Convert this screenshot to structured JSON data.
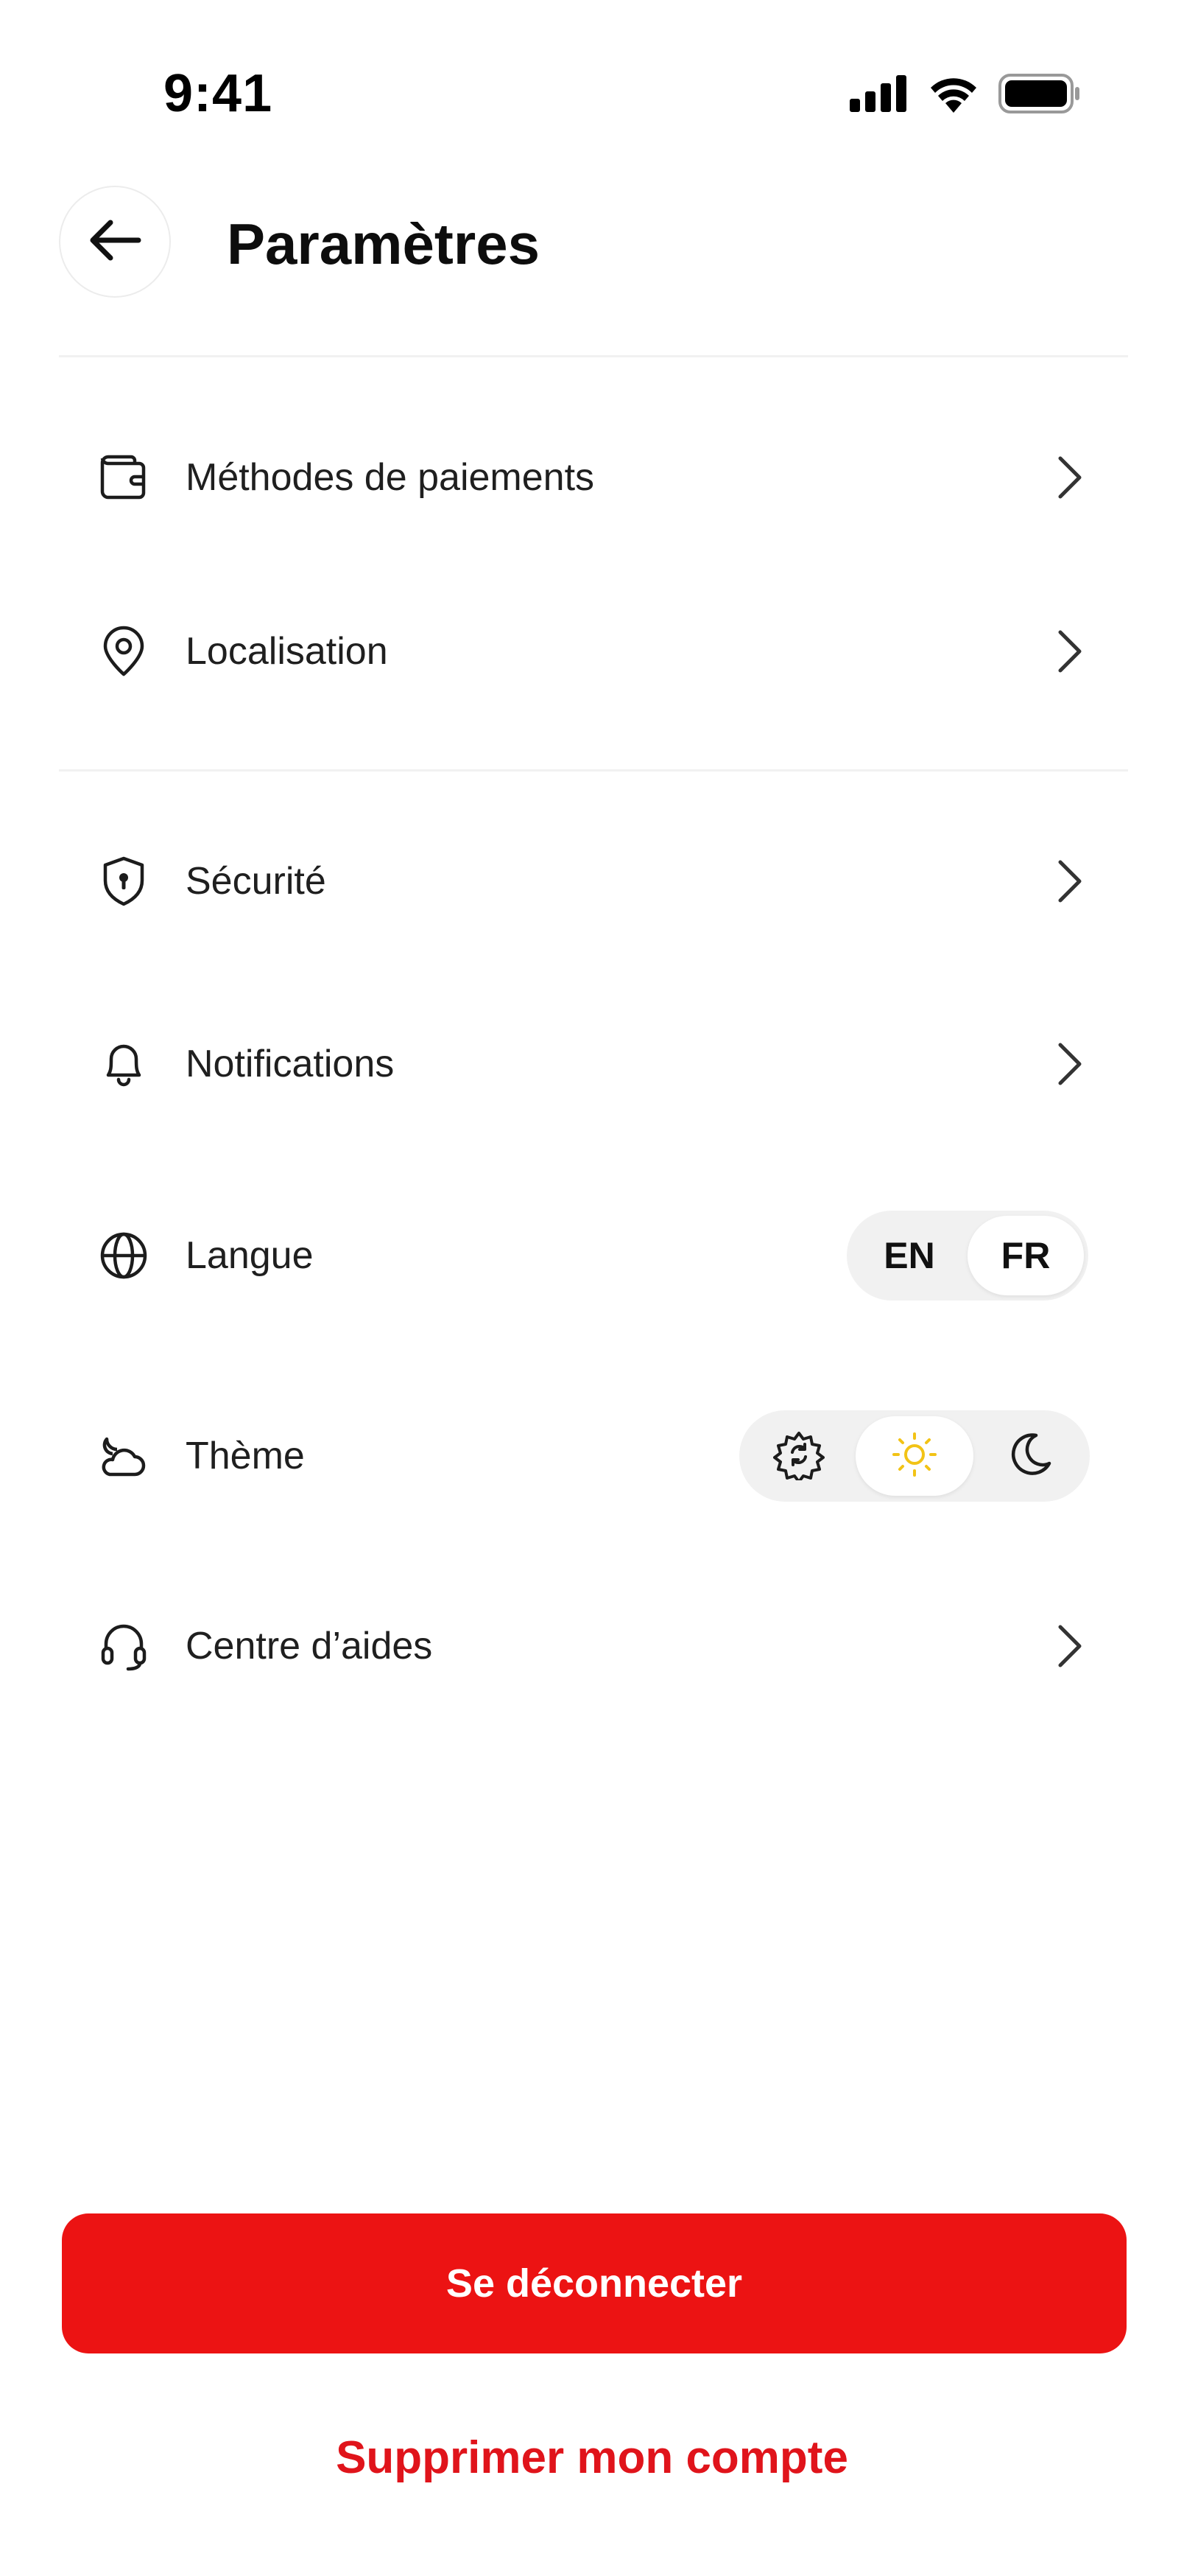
{
  "status_bar": {
    "time": "9:41",
    "icons": [
      "signal-icon",
      "wifi-icon",
      "battery-icon"
    ]
  },
  "header": {
    "title": "Paramètres",
    "back_icon": "arrow-left-icon"
  },
  "sections": [
    {
      "items": [
        {
          "label": "Méthodes de paiements",
          "icon": "wallet-icon",
          "control": "chevron"
        },
        {
          "label": "Localisation",
          "icon": "location-pin-icon",
          "control": "chevron"
        }
      ]
    },
    {
      "items": [
        {
          "label": "Sécurité",
          "icon": "shield-lock-icon",
          "control": "chevron"
        },
        {
          "label": "Notifications",
          "icon": "bell-icon",
          "control": "chevron"
        },
        {
          "label": "Langue",
          "icon": "globe-icon",
          "control": "language-toggle"
        },
        {
          "label": "Thème",
          "icon": "cloud-sun-icon",
          "control": "theme-toggle"
        },
        {
          "label": "Centre d’aides",
          "icon": "headset-icon",
          "control": "chevron"
        }
      ]
    }
  ],
  "language_toggle": {
    "options": [
      "EN",
      "FR"
    ],
    "selected": "FR"
  },
  "theme_toggle": {
    "options": [
      "system-gear-icon",
      "sun-icon",
      "moon-icon"
    ],
    "selected": "sun-icon"
  },
  "actions": {
    "logout_label": "Se déconnecter",
    "delete_account_label": "Supprimer mon compte"
  },
  "colors": {
    "accent_red": "#EC1313",
    "delete_red": "#E0141B",
    "sun_yellow": "#F2C316",
    "toggle_bg": "#F1F1F1"
  }
}
